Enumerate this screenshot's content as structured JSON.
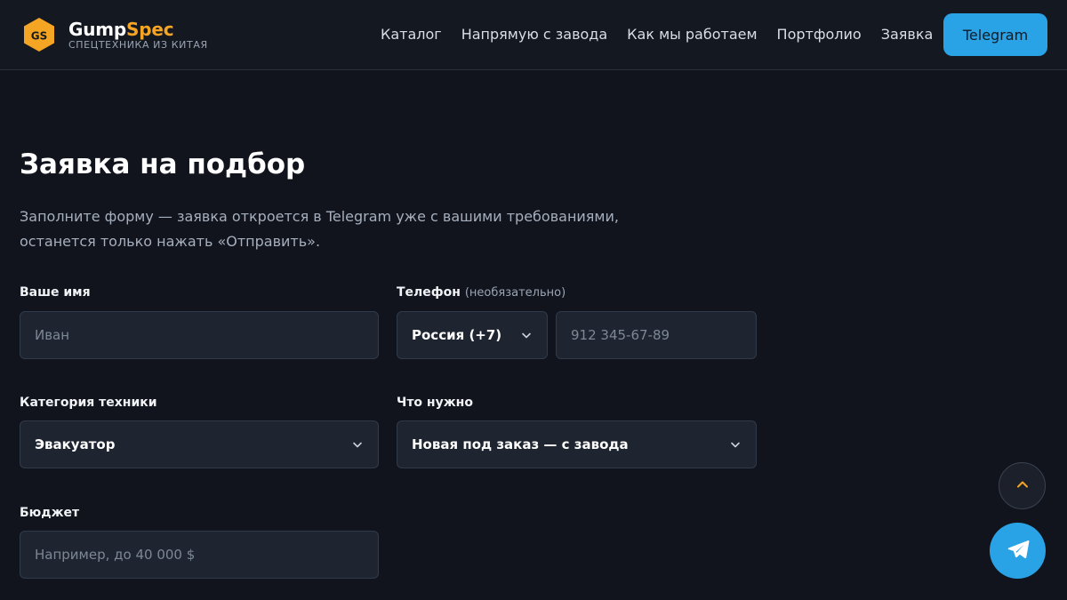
{
  "brand": {
    "badge": "GS",
    "name_white": "Gump",
    "name_orange": "Spec",
    "tagline": "СПЕЦТЕХНИКА ИЗ КИТАЯ"
  },
  "nav": {
    "items": [
      "Каталог",
      "Напрямую с завода",
      "Как мы работаем",
      "Портфолио",
      "Заявка"
    ],
    "cta": "Telegram"
  },
  "page": {
    "title": "Заявка на подбор",
    "lead_line1": "Заполните форму — заявка откроется в Telegram уже с вашими требованиями,",
    "lead_line2": "останется только нажать «Отправить»."
  },
  "form": {
    "name": {
      "label": "Ваше имя",
      "placeholder": "Иван"
    },
    "phone": {
      "label": "Телефон",
      "note": "(необязательно)",
      "country": "Россия (+7)",
      "placeholder": "912 345-67-89"
    },
    "category": {
      "label": "Категория техники",
      "value": "Эвакуатор"
    },
    "need": {
      "label": "Что нужно",
      "value": "Новая под заказ — с завода"
    },
    "budget": {
      "label": "Бюджет",
      "placeholder": "Например, до 40 000 $"
    }
  },
  "colors": {
    "accent": "#f5a524",
    "telegram": "#2aa3e6",
    "background": "#11141d"
  },
  "icons": {
    "chevron": "chevron-down-icon",
    "scroll_top": "chevron-up-icon",
    "telegram": "paper-plane-icon"
  }
}
